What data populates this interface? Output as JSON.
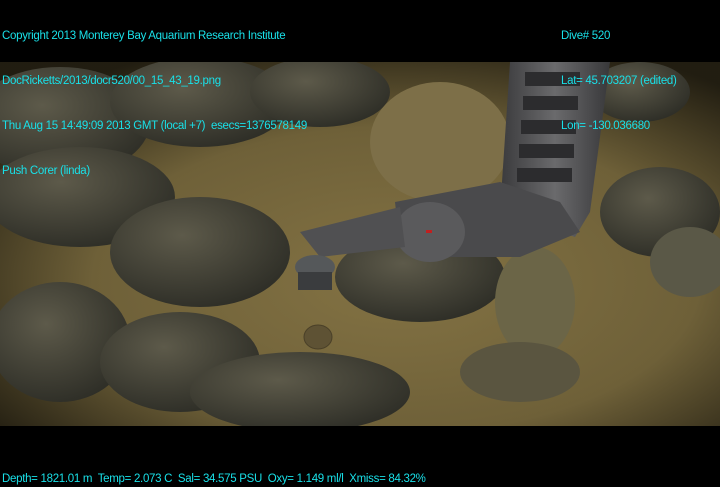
{
  "overlay_top_left": {
    "copyright": "Copyright 2013 Monterey Bay Aquarium Research Institute",
    "file": "DocRicketts/2013/docr520/00_15_43_19.png",
    "datetime": "Thu Aug 15 14:49:09 2013 GMT (local +7)  esecs=1376578149",
    "activity": "Push Corer (linda)"
  },
  "overlay_top_right": {
    "dive": "Dive# 520",
    "lat": "Lat= 45.703207 (edited)",
    "lon": "Lon= -130.036680"
  },
  "overlay_bottom": {
    "sensors": "Depth= 1821.01 m  Temp= 2.073 C  Sal= 34.575 PSU  Oxy= 1.149 ml/l  Xmiss= 84.32%"
  },
  "colors": {
    "overlay_text": "#19e0e8",
    "sediment": "#7a6a3e",
    "rock": "#3f3f36"
  }
}
